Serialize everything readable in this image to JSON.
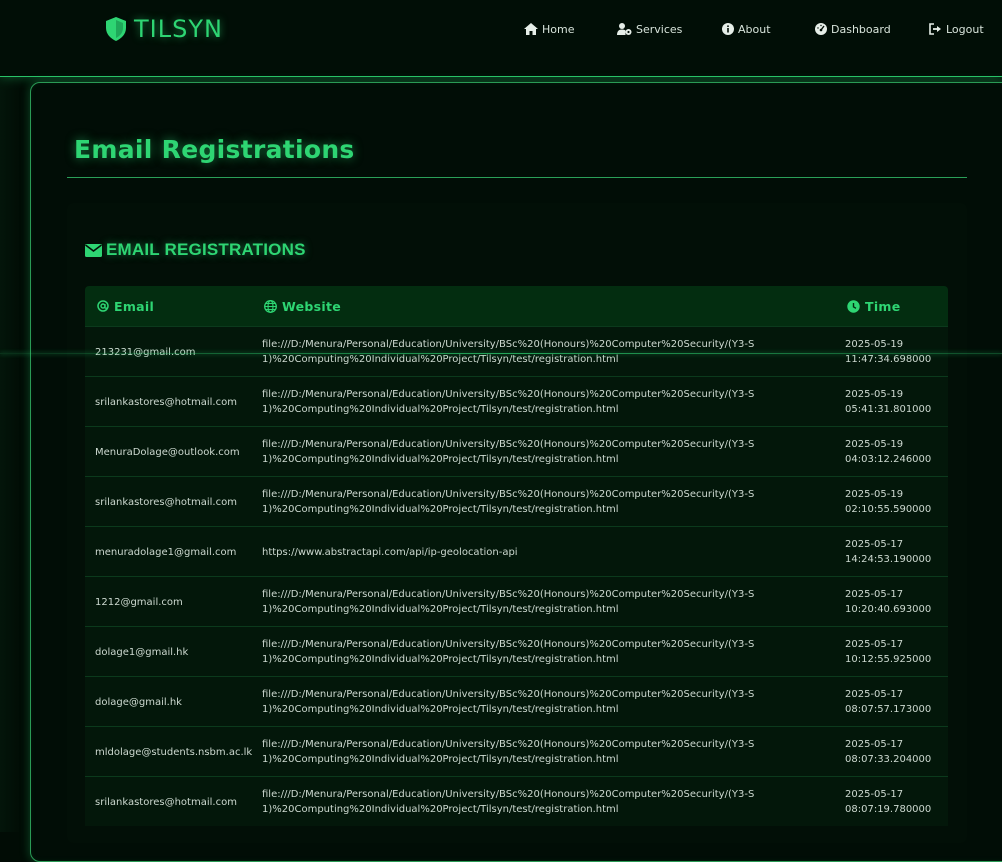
{
  "brand": {
    "name": "TILSYN"
  },
  "nav": [
    {
      "label": "Home",
      "icon": "home-icon"
    },
    {
      "label": "Services",
      "icon": "user-cog-icon"
    },
    {
      "label": "About",
      "icon": "info-icon"
    },
    {
      "label": "Dashboard",
      "icon": "dashboard-icon"
    },
    {
      "label": "Logout",
      "icon": "logout-icon"
    }
  ],
  "page": {
    "title": "Email Registrations"
  },
  "section": {
    "title": "EMAIL REGISTRATIONS",
    "icon": "envelope-icon"
  },
  "table": {
    "headers": {
      "email": "Email",
      "website": "Website",
      "time": "Time"
    },
    "rows": [
      {
        "email": "213231@gmail.com",
        "website": "file:///D:/Menura/Personal/Education/University/BSc%20(Honours)%20Computer%20Security/(Y3-S1)%20Computing%20Individual%20Project/Tilsyn/test/registration.html",
        "time": "2025-05-19 11:47:34.698000"
      },
      {
        "email": "srilankastores@hotmail.com",
        "website": "file:///D:/Menura/Personal/Education/University/BSc%20(Honours)%20Computer%20Security/(Y3-S1)%20Computing%20Individual%20Project/Tilsyn/test/registration.html",
        "time": "2025-05-19 05:41:31.801000"
      },
      {
        "email": "MenuraDolage@outlook.com",
        "website": "file:///D:/Menura/Personal/Education/University/BSc%20(Honours)%20Computer%20Security/(Y3-S1)%20Computing%20Individual%20Project/Tilsyn/test/registration.html",
        "time": "2025-05-19 04:03:12.246000"
      },
      {
        "email": "srilankastores@hotmail.com",
        "website": "file:///D:/Menura/Personal/Education/University/BSc%20(Honours)%20Computer%20Security/(Y3-S1)%20Computing%20Individual%20Project/Tilsyn/test/registration.html",
        "time": "2025-05-19 02:10:55.590000"
      },
      {
        "email": "menuradolage1@gmail.com",
        "website": "https://www.abstractapi.com/api/ip-geolocation-api",
        "time": "2025-05-17 14:24:53.190000"
      },
      {
        "email": "1212@gmail.com",
        "website": "file:///D:/Menura/Personal/Education/University/BSc%20(Honours)%20Computer%20Security/(Y3-S1)%20Computing%20Individual%20Project/Tilsyn/test/registration.html",
        "time": "2025-05-17 10:20:40.693000"
      },
      {
        "email": "dolage1@gmail.hk",
        "website": "file:///D:/Menura/Personal/Education/University/BSc%20(Honours)%20Computer%20Security/(Y3-S1)%20Computing%20Individual%20Project/Tilsyn/test/registration.html",
        "time": "2025-05-17 10:12:55.925000"
      },
      {
        "email": "dolage@gmail.hk",
        "website": "file:///D:/Menura/Personal/Education/University/BSc%20(Honours)%20Computer%20Security/(Y3-S1)%20Computing%20Individual%20Project/Tilsyn/test/registration.html",
        "time": "2025-05-17 08:07:57.173000"
      },
      {
        "email": "mldolage@students.nsbm.ac.lk",
        "website": "file:///D:/Menura/Personal/Education/University/BSc%20(Honours)%20Computer%20Security/(Y3-S1)%20Computing%20Individual%20Project/Tilsyn/test/registration.html",
        "time": "2025-05-17 08:07:33.204000"
      },
      {
        "email": "srilankastores@hotmail.com",
        "website": "file:///D:/Menura/Personal/Education/University/BSc%20(Honours)%20Computer%20Security/(Y3-S1)%20Computing%20Individual%20Project/Tilsyn/test/registration.html",
        "time": "2025-05-17 08:07:19.780000"
      }
    ]
  },
  "colors": {
    "accent": "#2ed573",
    "background": "#010c05",
    "header_row": "#032d10",
    "row": "#03170a"
  }
}
